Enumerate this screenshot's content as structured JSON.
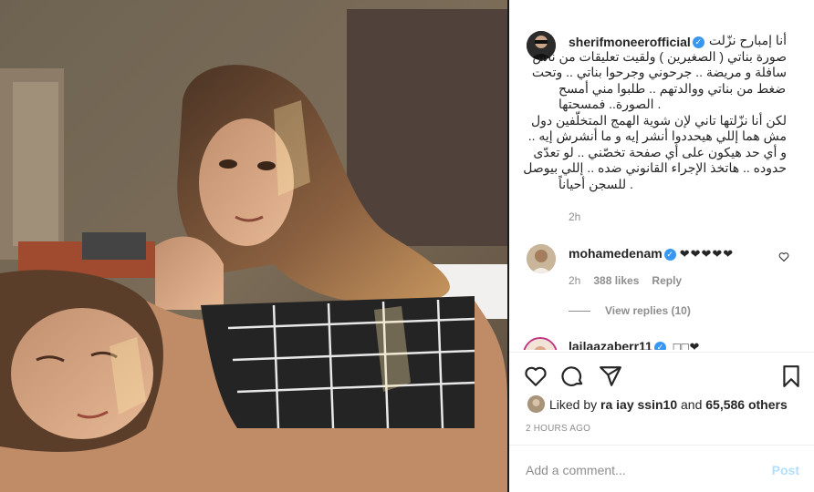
{
  "post": {
    "author": "sherifmoneerofficial",
    "verified_icon": "verified-badge-icon",
    "caption_lines": [
      "أنا إمبارح نزّلت",
      "صورة بناتي ( الصغيرين ) ولقيت تعليقات من ناس",
      "سافلة و مريضة .. جرحوني وجرحوا بناتي .. وتحت",
      "ضغط من بناتي ووالدتهم .. طلبوا مني أمسح",
      ". الصورة.. فمسحتها",
      "لكن أنا نزّلتها تاني لإن شوية الهمج المتخلّفين دول",
      "مش هما إللي هيحددوا أنشر إيه و ما أنشرش إيه ..",
      "و أي حد هيكون على أي صفحة تخصّني .. لو تعدّى",
      "حدوده .. هاتخذ الإجراء القانوني ضده .. إللي بيوصل",
      ". للسجن أحياناً"
    ],
    "caption_time": "2h",
    "likes_text_prefix": "Liked by",
    "likes_user": "ra iay ssin10",
    "likes_and": "and",
    "likes_count": "65,586 others",
    "posted_ago": "2 HOURS AGO",
    "add_comment_placeholder": "Add a comment...",
    "post_button": "Post"
  },
  "comments": [
    {
      "user": "mohamedenam",
      "hearts": "❤❤❤❤❤",
      "time": "2h",
      "likes": "388 likes",
      "reply": "Reply",
      "view_replies": "View replies (10)"
    },
    {
      "user": "lailaazaberr11",
      "text": "□□❤"
    }
  ],
  "icons": {
    "like": "heart-icon",
    "comment": "comment-icon",
    "share": "share-icon",
    "save": "bookmark-icon",
    "comment_like": "small-heart-icon"
  },
  "colors": {
    "accent": "#3897f0",
    "text": "#262626",
    "muted": "#8e8e8e",
    "post_disabled": "#b2dffc"
  }
}
